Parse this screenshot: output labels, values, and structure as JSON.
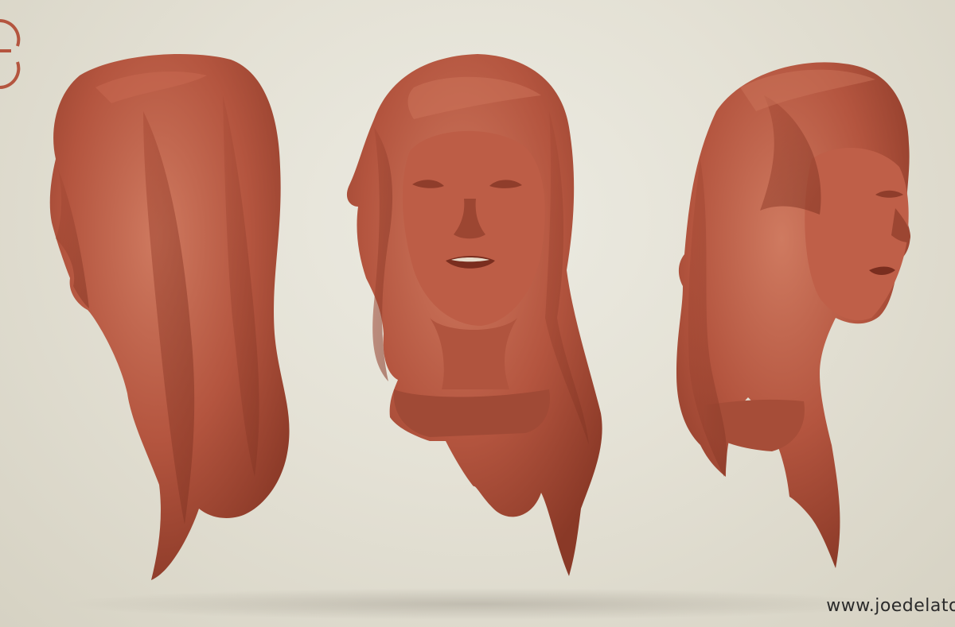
{
  "scene": {
    "description_kind": "3d-sculpt-turnaround",
    "clay_color": "#b4553f",
    "clay_shadow": "#8c3a2a",
    "clay_highlight": "#d07a62",
    "background_color": "#e6e3d8"
  },
  "views": [
    {
      "name": "profile-left"
    },
    {
      "name": "front"
    },
    {
      "name": "three-quarter-right"
    }
  ],
  "logo": {
    "color": "#b4553f"
  },
  "watermark": {
    "text": "www.joedelato"
  }
}
